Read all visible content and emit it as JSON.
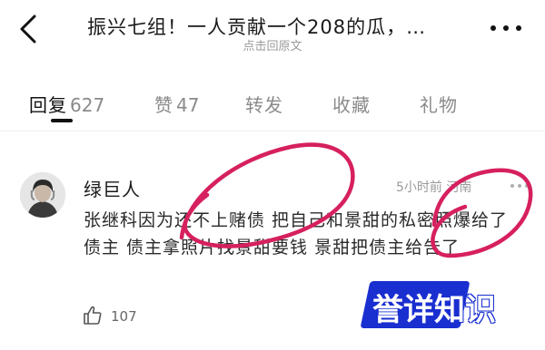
{
  "header": {
    "title": "振兴七组！一人贡献一个208的瓜，…",
    "subtitle": "点击回原文"
  },
  "tabs": [
    {
      "label": "回复",
      "count": "627",
      "active": true
    },
    {
      "label": "赞",
      "count": "47",
      "active": false
    },
    {
      "label": "转发",
      "count": "",
      "active": false
    },
    {
      "label": "收藏",
      "count": "",
      "active": false
    },
    {
      "label": "礼物",
      "count": "",
      "active": false
    }
  ],
  "comment": {
    "username": "绿巨人",
    "meta": "5小时前 河南",
    "text": "张继科因为还不上赌债 把自己和景甜的私密照爆给了债主 债主拿照片找景甜要钱 景甜把债主给告了",
    "likes": "107"
  },
  "watermark": {
    "text": "誉详知识"
  },
  "colors": {
    "annotation": "#d6205f",
    "watermark_bg": "#1a2fd0",
    "muted_text": "#9a9a9a"
  }
}
